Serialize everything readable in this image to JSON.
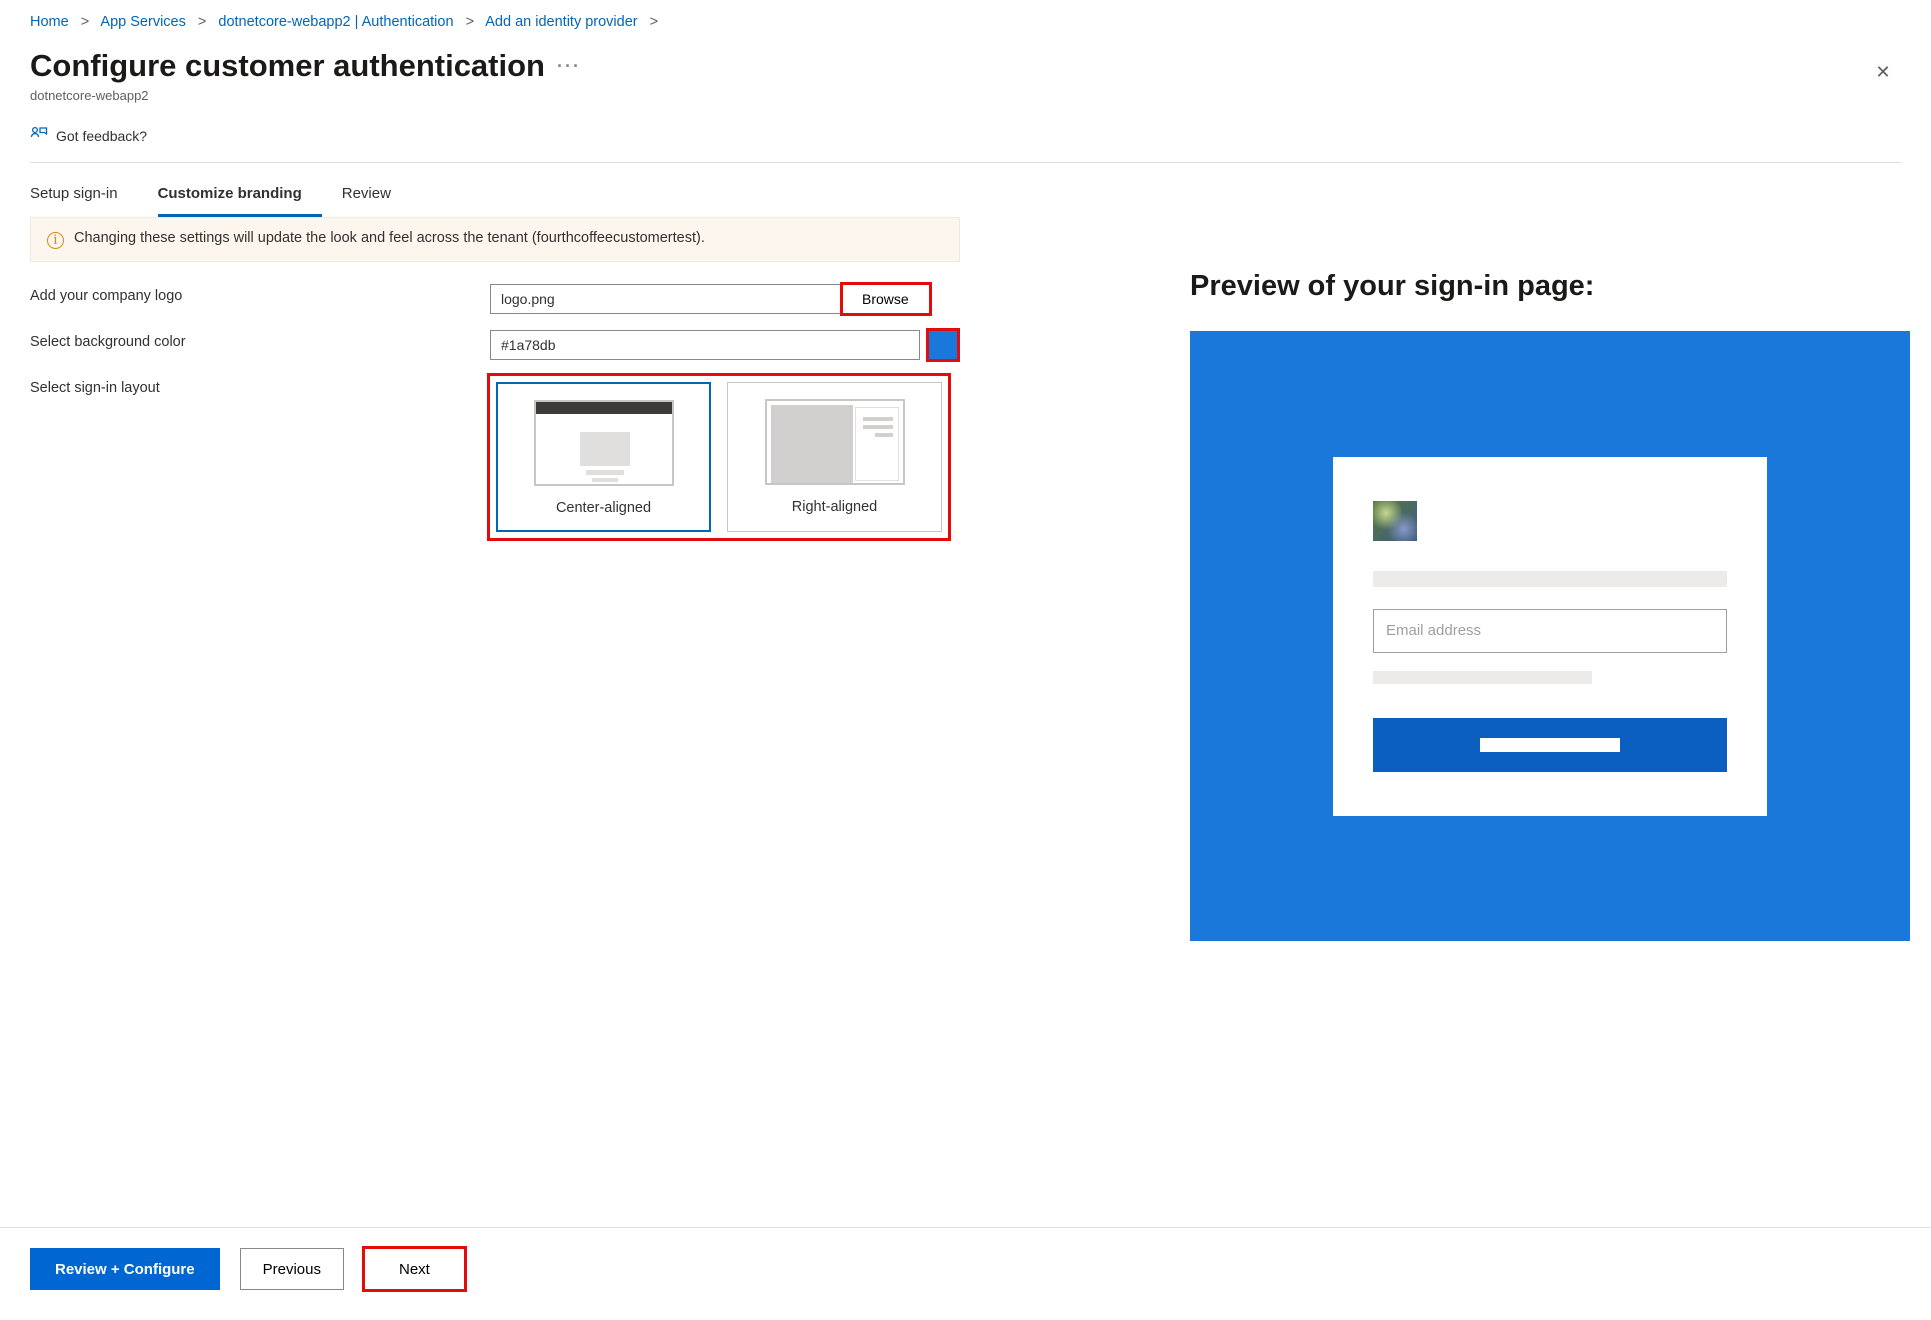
{
  "breadcrumb": {
    "items": [
      "Home",
      "App Services",
      "dotnetcore-webapp2 | Authentication",
      "Add an identity provider"
    ]
  },
  "header": {
    "title": "Configure customer authentication",
    "subtitle": "dotnetcore-webapp2"
  },
  "feedback": {
    "label": "Got feedback?"
  },
  "tabs": {
    "items": [
      "Setup sign-in",
      "Customize branding",
      "Review"
    ],
    "active": 1
  },
  "banner": {
    "text": "Changing these settings will update the look and feel across the tenant (fourthcoffeecustomertest)."
  },
  "form": {
    "logo_label": "Add your company logo",
    "logo_value": "logo.png",
    "browse_label": "Browse",
    "bg_label": "Select background color",
    "bg_value": "#1a78db",
    "layout_label": "Select sign-in layout",
    "layout_options": {
      "center": "Center-aligned",
      "right": "Right-aligned"
    },
    "layout_selected": "center"
  },
  "preview": {
    "title": "Preview of your sign-in page:",
    "email_placeholder": "Email address"
  },
  "footer": {
    "review": "Review + Configure",
    "previous": "Previous",
    "next": "Next"
  }
}
